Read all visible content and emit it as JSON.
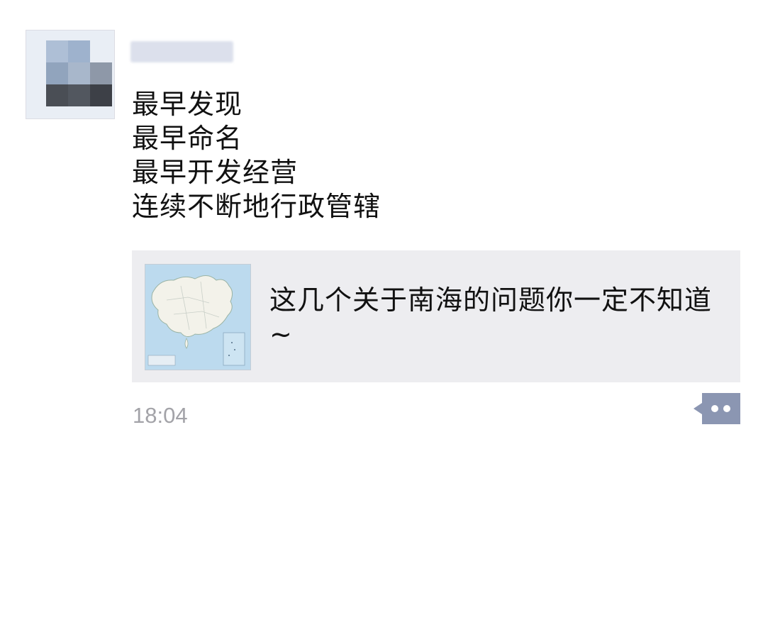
{
  "post": {
    "lines": [
      "最早发现",
      "最早命名",
      "最早开发经营",
      "连续不断地行政管辖"
    ]
  },
  "link_card": {
    "title": "这几个关于南海的问题你一定不知道~",
    "thumbnail_icon": "china-map-thumbnail"
  },
  "timestamp": "18:04",
  "more_button_icon": "comment-more-icon",
  "colors": {
    "card_bg": "#ededf0",
    "timestamp": "#a3a3a8",
    "more_button": "#8b96b2"
  }
}
